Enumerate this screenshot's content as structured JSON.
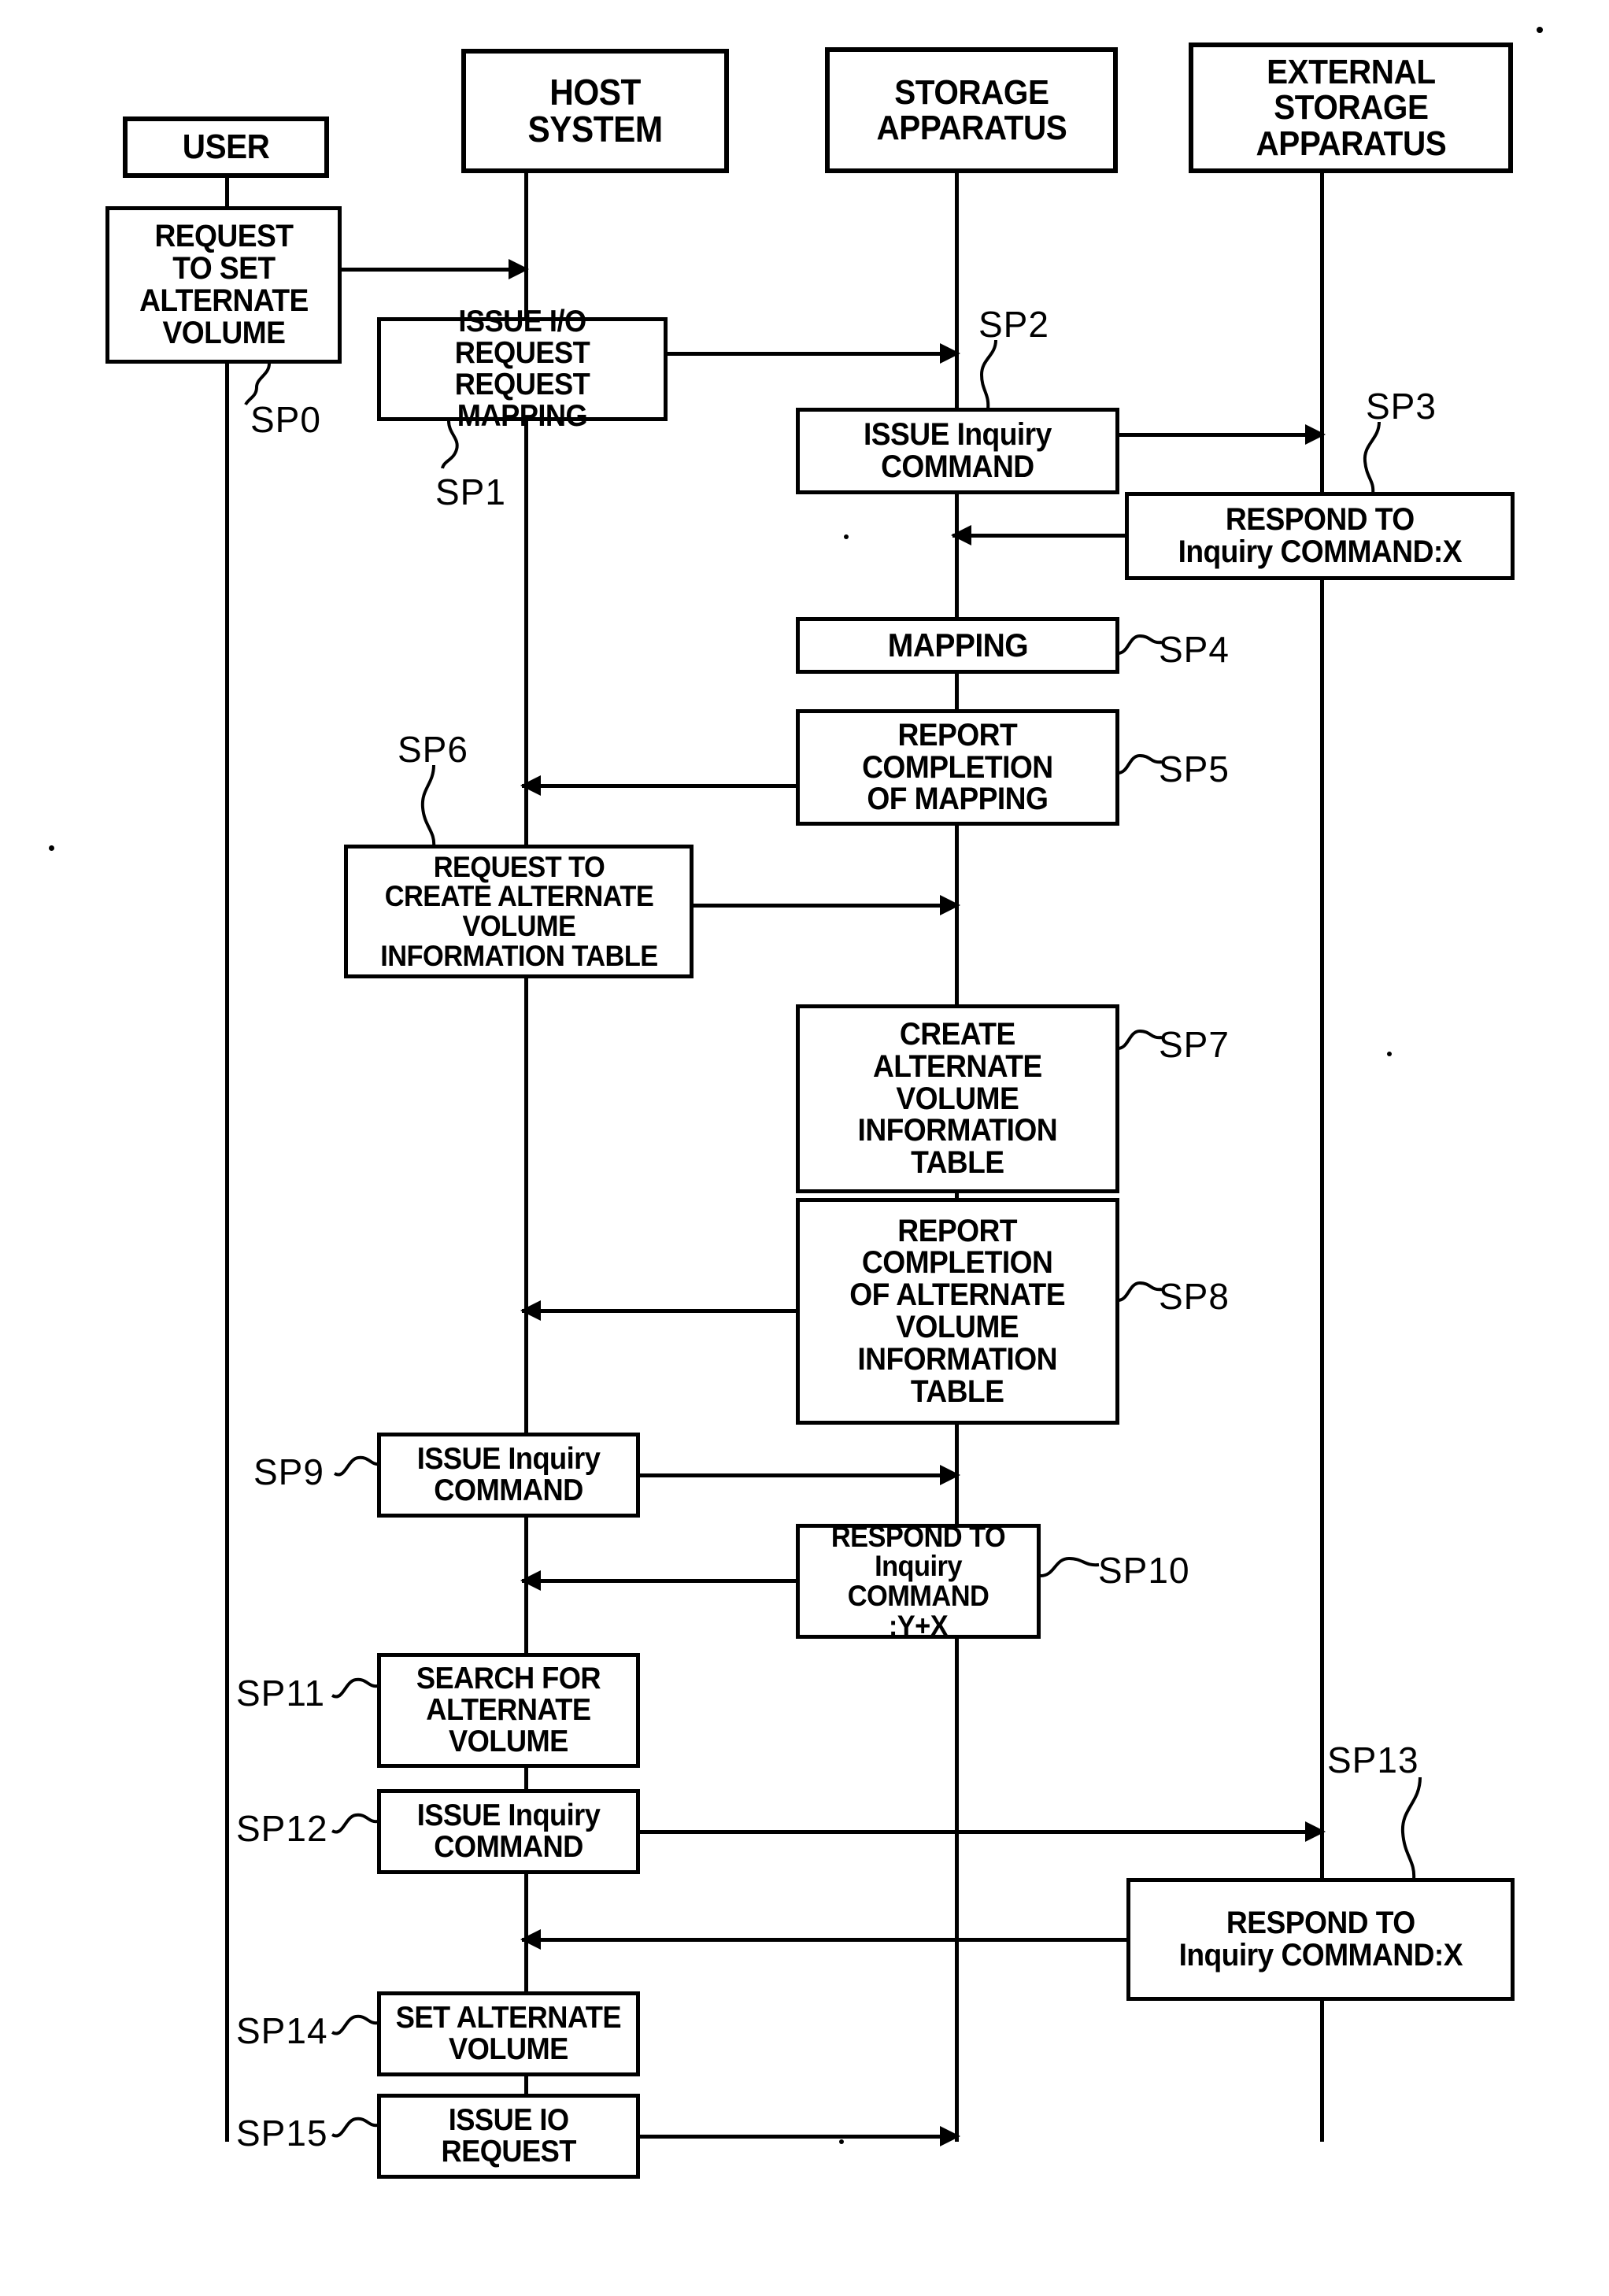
{
  "actors": [
    {
      "id": "user",
      "label": "USER"
    },
    {
      "id": "host",
      "label": "HOST\nSYSTEM"
    },
    {
      "id": "storage",
      "label": "STORAGE\nAPPARATUS"
    },
    {
      "id": "external",
      "label": "EXTERNAL\nSTORAGE\nAPPARATUS"
    }
  ],
  "steps": [
    {
      "number": "SP0",
      "actor": "user",
      "text": "REQUEST\nTO SET\nALTERNATE\nVOLUME"
    },
    {
      "number": "SP1",
      "actor": "host",
      "text": "ISSUE I/O REQUEST\nREQUEST MAPPING"
    },
    {
      "number": "SP2",
      "actor": "storage",
      "text": "ISSUE Inquiry\nCOMMAND"
    },
    {
      "number": "SP3",
      "actor": "external",
      "text": "RESPOND TO\nInquiry COMMAND:X"
    },
    {
      "number": "SP4",
      "actor": "storage",
      "text": "MAPPING"
    },
    {
      "number": "SP5",
      "actor": "storage",
      "text": "REPORT\nCOMPLETION\nOF MAPPING"
    },
    {
      "number": "SP6",
      "actor": "host",
      "text": "REQUEST TO\nCREATE ALTERNATE\nVOLUME\nINFORMATION TABLE"
    },
    {
      "number": "SP7",
      "actor": "storage",
      "text": "CREATE\nALTERNATE\nVOLUME\nINFORMATION\nTABLE"
    },
    {
      "number": "SP8",
      "actor": "storage",
      "text": "REPORT\nCOMPLETION\nOF ALTERNATE\nVOLUME\nINFORMATION\nTABLE"
    },
    {
      "number": "SP9",
      "actor": "host",
      "text": "ISSUE Inquiry\nCOMMAND"
    },
    {
      "number": "SP10",
      "actor": "storage",
      "text": "RESPOND TO\nInquiry COMMAND\n:Y+X"
    },
    {
      "number": "SP11",
      "actor": "host",
      "text": "SEARCH FOR\nALTERNATE\nVOLUME"
    },
    {
      "number": "SP12",
      "actor": "host",
      "text": "ISSUE Inquiry\nCOMMAND"
    },
    {
      "number": "SP13",
      "actor": "external",
      "text": "RESPOND TO\nInquiry COMMAND:X"
    },
    {
      "number": "SP14",
      "actor": "host",
      "text": "SET ALTERNATE\nVOLUME"
    },
    {
      "number": "SP15",
      "actor": "host",
      "text": "ISSUE IO\nREQUEST"
    }
  ],
  "arrows": [
    {
      "from": "user",
      "to": "host",
      "direction": "right",
      "step": "SP0"
    },
    {
      "from": "host",
      "to": "storage",
      "direction": "right",
      "step": "SP1"
    },
    {
      "from": "storage",
      "to": "external",
      "direction": "right",
      "step": "SP2"
    },
    {
      "from": "external",
      "to": "storage",
      "direction": "left",
      "step": "SP3"
    },
    {
      "from": "storage",
      "to": "host",
      "direction": "left",
      "step": "SP5"
    },
    {
      "from": "host",
      "to": "storage",
      "direction": "right",
      "step": "SP6"
    },
    {
      "from": "storage",
      "to": "host",
      "direction": "left",
      "step": "SP8"
    },
    {
      "from": "host",
      "to": "storage",
      "direction": "right",
      "step": "SP9"
    },
    {
      "from": "storage",
      "to": "host",
      "direction": "left",
      "step": "SP10"
    },
    {
      "from": "host",
      "to": "external",
      "direction": "right",
      "step": "SP12"
    },
    {
      "from": "external",
      "to": "host",
      "direction": "left",
      "step": "SP13"
    },
    {
      "from": "host",
      "to": "storage",
      "direction": "right",
      "step": "SP15"
    }
  ],
  "colors": {
    "line": "#000000",
    "background": "#ffffff"
  }
}
